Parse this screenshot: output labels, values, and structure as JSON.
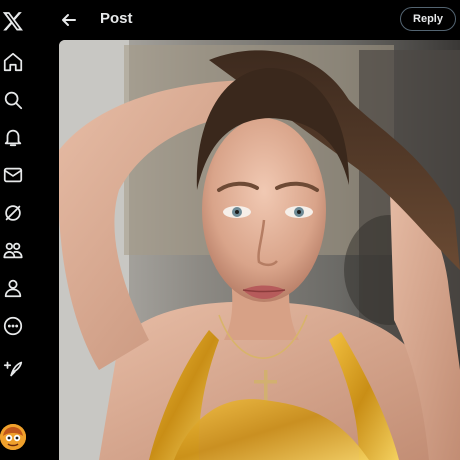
{
  "header": {
    "title": "Post",
    "back_icon": "arrow-left-icon",
    "reply_label": "Reply"
  },
  "nav": {
    "items": [
      {
        "name": "x-logo-icon"
      },
      {
        "name": "home-icon"
      },
      {
        "name": "search-icon"
      },
      {
        "name": "bell-icon"
      },
      {
        "name": "envelope-icon"
      },
      {
        "name": "grok-icon"
      },
      {
        "name": "communities-icon"
      },
      {
        "name": "person-icon"
      },
      {
        "name": "more-circle-icon"
      },
      {
        "name": "compose-icon"
      }
    ],
    "avatar": "user-avatar"
  },
  "media": {
    "description_icon": "post-photo"
  },
  "colors": {
    "background": "#000000",
    "text": "#e7e9ea",
    "border": "#536471"
  }
}
